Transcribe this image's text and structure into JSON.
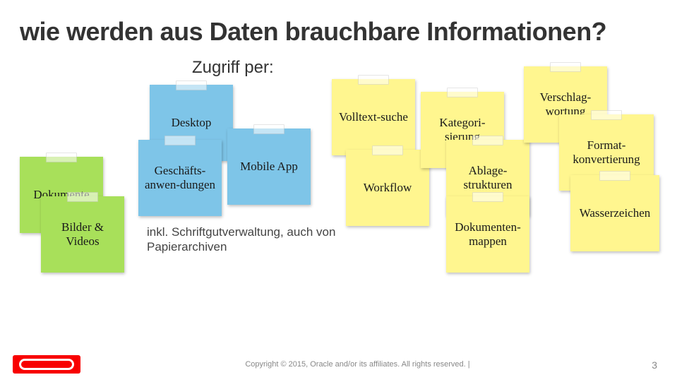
{
  "title": "wie werden aus Daten brauchbare Informationen?",
  "access_label": "Zugriff per:",
  "footnote": "inkl. Schriftgutverwaltung, auch von Papierarchiven",
  "stickies": {
    "dokumente": "Dokumente",
    "bilder_videos": "Bilder & Videos",
    "desktop": "Desktop",
    "geschaefts": "Geschäfts-anwen-dungen",
    "mobile": "Mobile App",
    "volltext": "Volltext-suche",
    "workflow": "Workflow",
    "kategori": "Kategori-sierung",
    "ablage": "Ablage-strukturen",
    "dokumappen": "Dokumenten-mappen",
    "verschlag": "Verschlag-wortung",
    "format": "Format-konvertierung",
    "wasserz": "Wasserzeichen"
  },
  "logo_text": "ORACLE",
  "copyright": "Copyright © 2015, Oracle and/or its affiliates. All rights reserved.  |",
  "page_number": "3"
}
